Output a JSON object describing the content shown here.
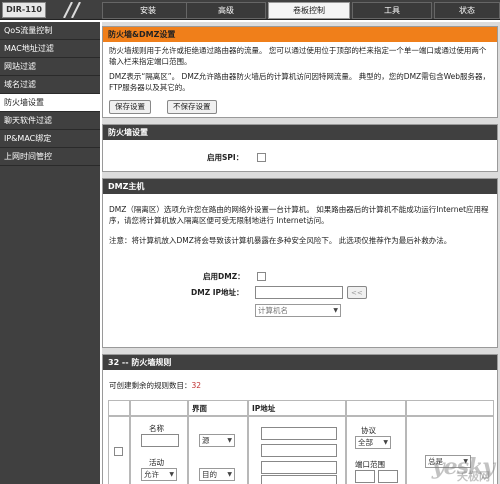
{
  "brand": {
    "model": "DIR-110"
  },
  "tabs": [
    {
      "label": "安装"
    },
    {
      "label": "高级"
    },
    {
      "label": "卷板控制"
    },
    {
      "label": "工具"
    },
    {
      "label": "状态"
    }
  ],
  "sidebar": {
    "items": [
      {
        "label": "QoS流量控制"
      },
      {
        "label": "MAC地址过滤"
      },
      {
        "label": "网站过滤"
      },
      {
        "label": "域名过滤"
      },
      {
        "label": "防火墙设置"
      },
      {
        "label": "聊天软件过滤"
      },
      {
        "label": "IP&MAC绑定"
      },
      {
        "label": "上网时间管控"
      }
    ]
  },
  "firewall_dmz": {
    "title": "防火墙&DMZ设置",
    "desc1": "防火墙规则用于允许或拒绝通过路由器的流量。 您可以通过使用位于顶部的栏来指定一个单一端口或通过使用两个输入栏来指定端口范围。",
    "desc2": "DMZ表示“隔离区”。 DMZ允许路由器防火墙后的计算机访问因特网流量。 典型的，您的DMZ需包含Web服务器，FTP服务器以及其它的。",
    "save_label": "保存设置",
    "nosave_label": "不保存设置"
  },
  "firewall_settings": {
    "title": "防火墙设置",
    "spi_label": "启用SPI："
  },
  "dmz_host": {
    "title": "DMZ主机",
    "desc1": "DMZ（隔离区）选项允许您在路由的网络外设置一台计算机。 如果路由器后的计算机不能成功运行Internet应用程序，请您将计算机放入隔离区便可受无限制地进行 Internet访问。",
    "note": "注意：将计算机放入DMZ将会导致该计算机暴露在多种安全风险下。 此选项仅推荐作为最后补救办法。",
    "enable_label": "启用DMZ：",
    "ip_label": "DMZ IP地址：",
    "copy_btn": "<<",
    "computer_placeholder": "计算机名"
  },
  "rules": {
    "title": "32 -- 防火墙规则",
    "remaining_label": "可创建剩余的规则数目：",
    "remaining_value": "32",
    "col_interface": "界面",
    "col_ip": "IP地址",
    "name_label": "名称",
    "action_label": "活动",
    "action_value": "允许",
    "source_value": "源",
    "dest_value": "目的",
    "protocol_label": "协议",
    "protocol_value": "全部",
    "port_label": "端口范围",
    "schedule_value": "总是"
  },
  "watermark": {
    "main": "yesky",
    "sub": "天极网"
  }
}
